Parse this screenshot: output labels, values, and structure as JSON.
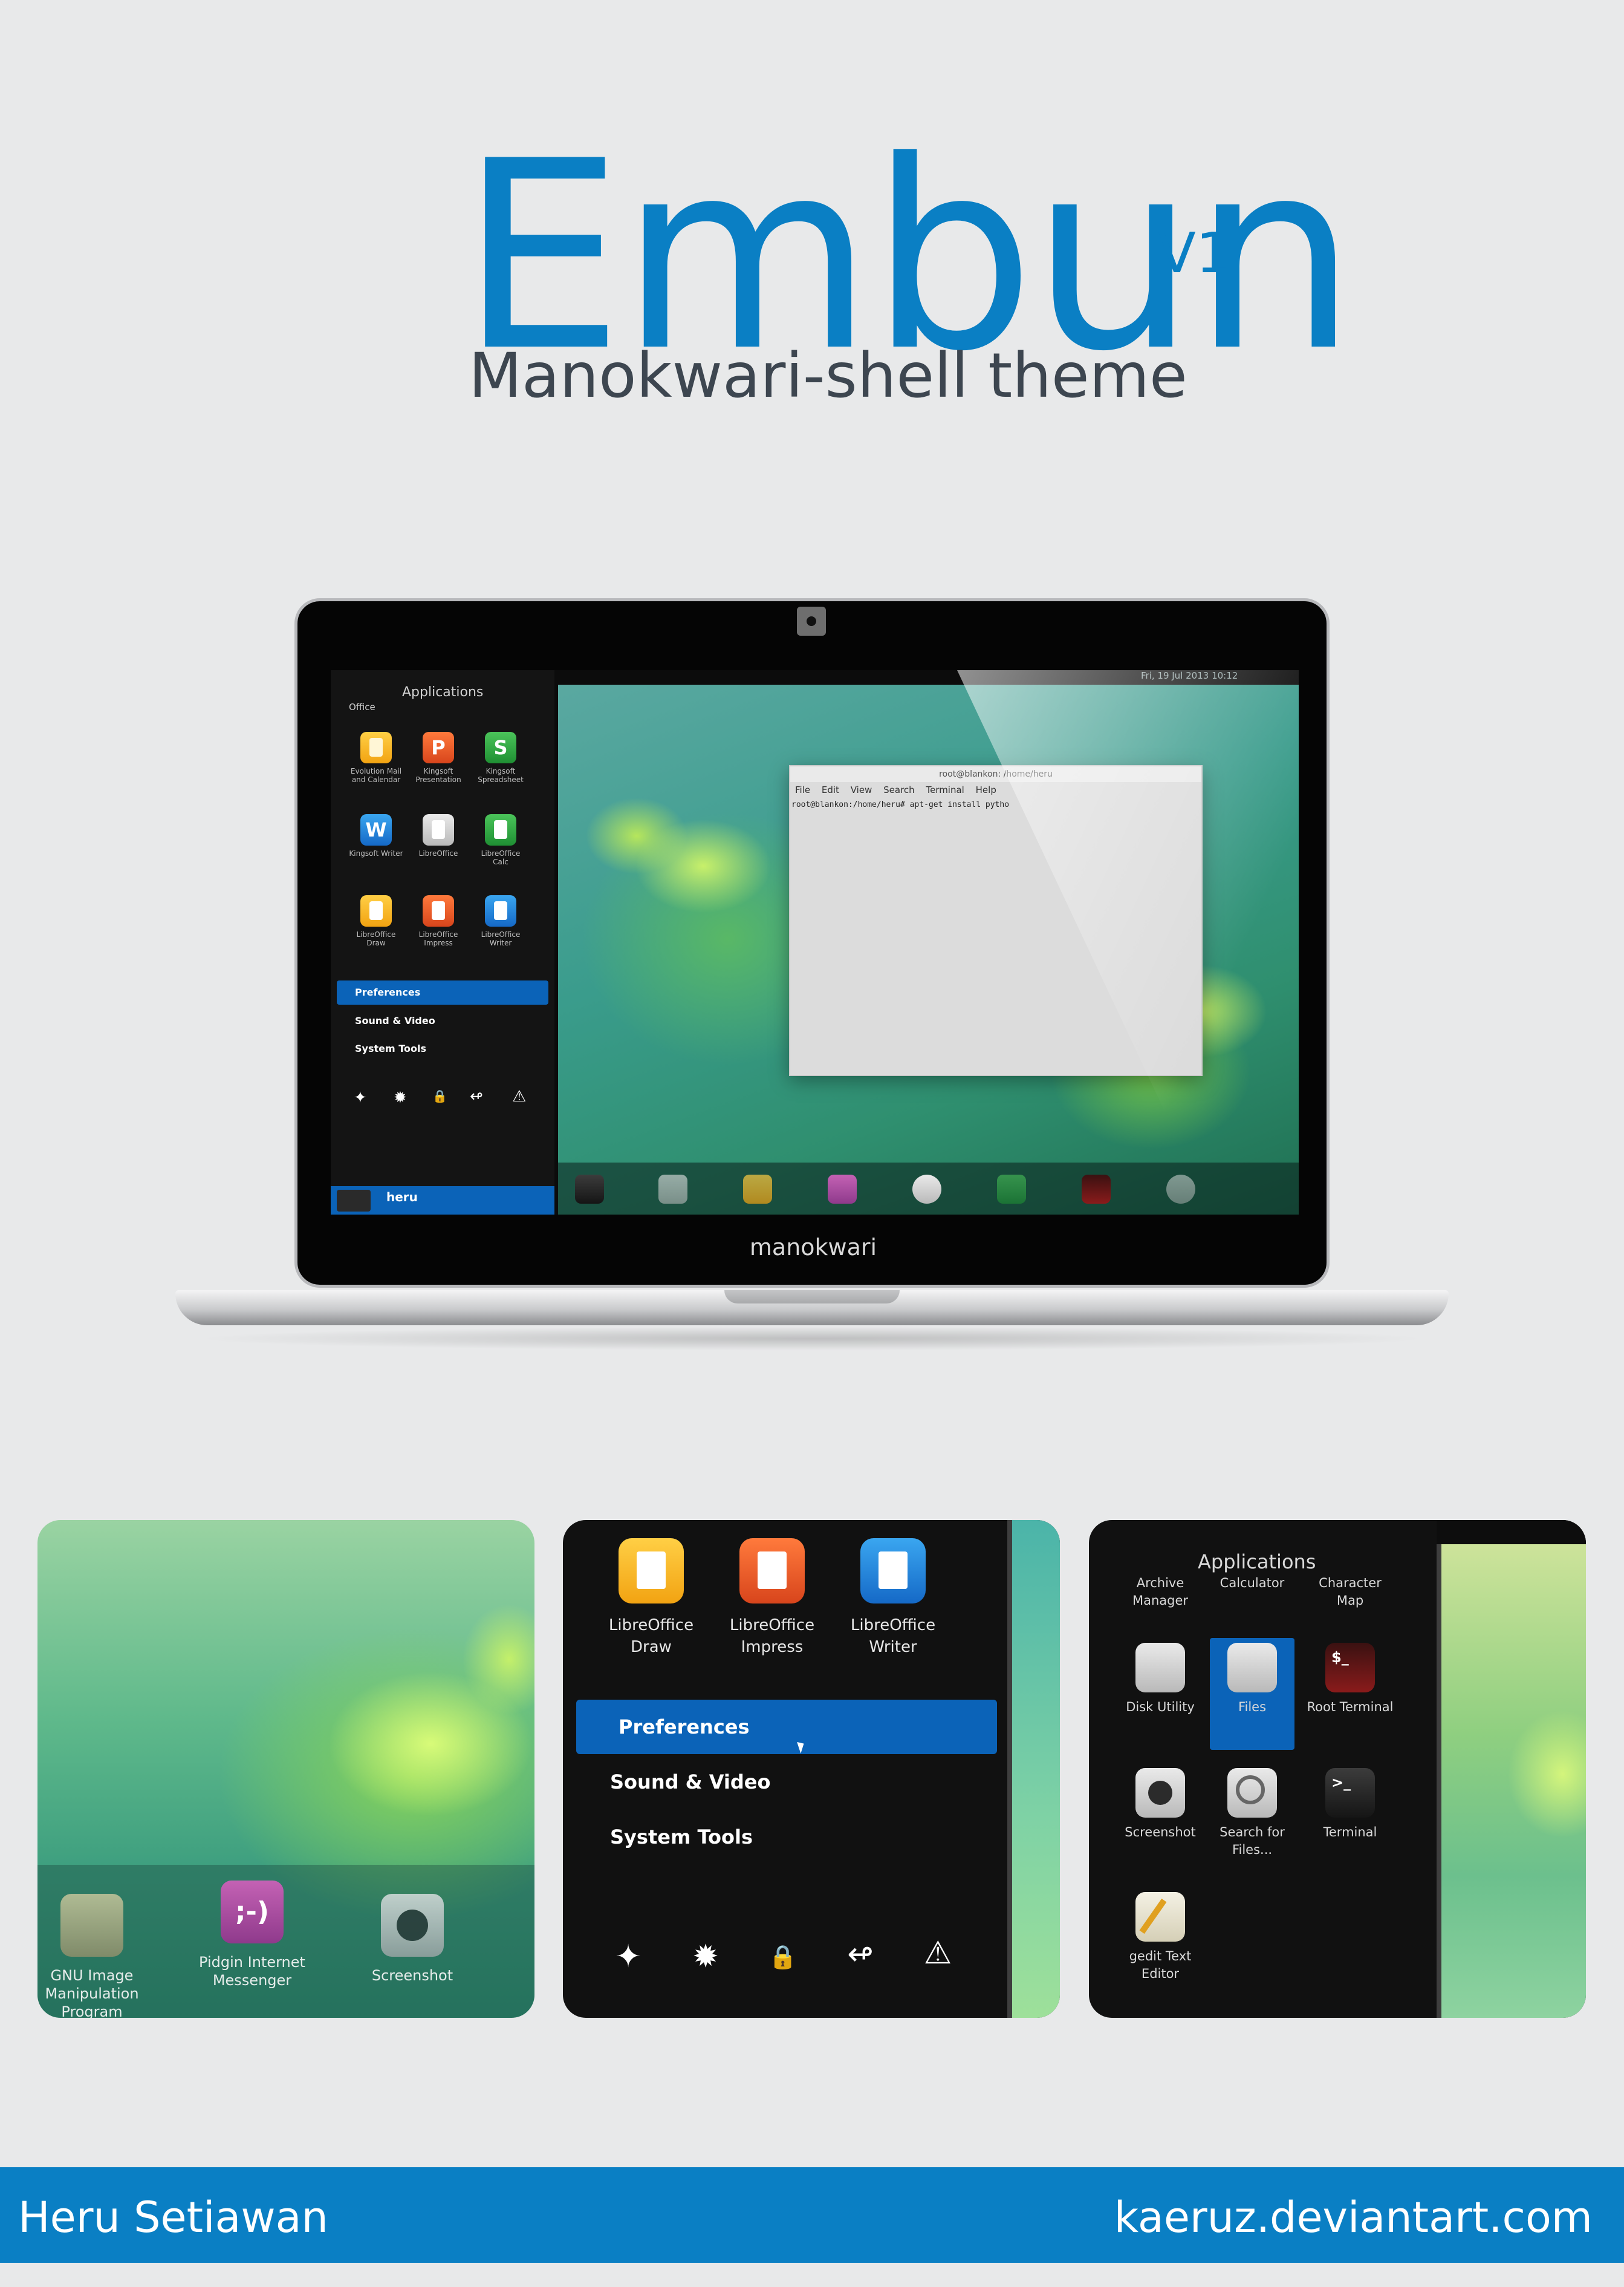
{
  "title": {
    "main": "Embun",
    "version": "V1",
    "subtitle": "Manokwari-shell theme"
  },
  "laptop": {
    "brand": "manokwari",
    "status": "Fri, 19 Jul 2013 10:12",
    "menu": {
      "header": "Applications",
      "category": "Office",
      "apps": [
        {
          "label": "Evolution Mail and Calendar",
          "icon": "evolution-icon"
        },
        {
          "label": "Kingsoft Presentation",
          "icon": "kingsoft-presentation-icon",
          "glyph": "P"
        },
        {
          "label": "Kingsoft Spreadsheet",
          "icon": "kingsoft-spreadsheet-icon",
          "glyph": "S"
        },
        {
          "label": "Kingsoft Writer",
          "icon": "kingsoft-writer-icon",
          "glyph": "W"
        },
        {
          "label": "LibreOffice",
          "icon": "libreoffice-icon"
        },
        {
          "label": "LibreOffice Calc",
          "icon": "libreoffice-calc-icon"
        },
        {
          "label": "LibreOffice Draw",
          "icon": "libreoffice-draw-icon"
        },
        {
          "label": "LibreOffice Impress",
          "icon": "libreoffice-impress-icon"
        },
        {
          "label": "LibreOffice Writer",
          "icon": "libreoffice-writer-icon"
        }
      ],
      "items": [
        "Preferences",
        "Sound & Video",
        "System Tools"
      ],
      "actions": [
        "✦",
        "✹",
        "🔒",
        "↫",
        "⚠"
      ],
      "user": "heru"
    },
    "terminal": {
      "title": "root@blankon: /home/heru",
      "menu": [
        "File",
        "Edit",
        "View",
        "Search",
        "Terminal",
        "Help"
      ],
      "line": "root@blankon:/home/heru# apt-get install pytho"
    }
  },
  "panel1": {
    "dock": [
      {
        "label": "GNU Image Manipulation Program",
        "icon": "gimp-icon"
      },
      {
        "label": "Pidgin Internet Messenger",
        "icon": "pidgin-icon",
        "glyph": ";-)"
      },
      {
        "label": "Screenshot",
        "icon": "screenshot-icon"
      }
    ]
  },
  "panel2": {
    "apps": [
      {
        "label": "LibreOffice Draw",
        "icon": "libreoffice-draw-icon"
      },
      {
        "label": "LibreOffice Impress",
        "icon": "libreoffice-impress-icon"
      },
      {
        "label": "LibreOffice Writer",
        "icon": "libreoffice-writer-icon"
      }
    ],
    "items": [
      "Preferences",
      "Sound & Video",
      "System Tools"
    ],
    "actions": [
      "✦",
      "✹",
      "🔒",
      "↫",
      "⚠"
    ]
  },
  "panel3": {
    "header": "Applications",
    "top_apps": [
      "Archive Manager",
      "Calculator",
      "Character Map"
    ],
    "apps": [
      {
        "label": "Disk Utility",
        "icon": "disk-utility-icon"
      },
      {
        "label": "Files",
        "icon": "files-icon"
      },
      {
        "label": "Root Terminal",
        "icon": "root-terminal-icon",
        "glyph": "$_"
      },
      {
        "label": "Screenshot",
        "icon": "screenshot-icon"
      },
      {
        "label": "Search for Files...",
        "icon": "search-files-icon"
      },
      {
        "label": "Terminal",
        "icon": "terminal-icon",
        "glyph": ">_"
      },
      {
        "label": "gedit Text Editor",
        "icon": "gedit-icon"
      }
    ]
  },
  "footer": {
    "author": "Heru Setiawan",
    "site": "kaeruz.deviantart.com"
  }
}
